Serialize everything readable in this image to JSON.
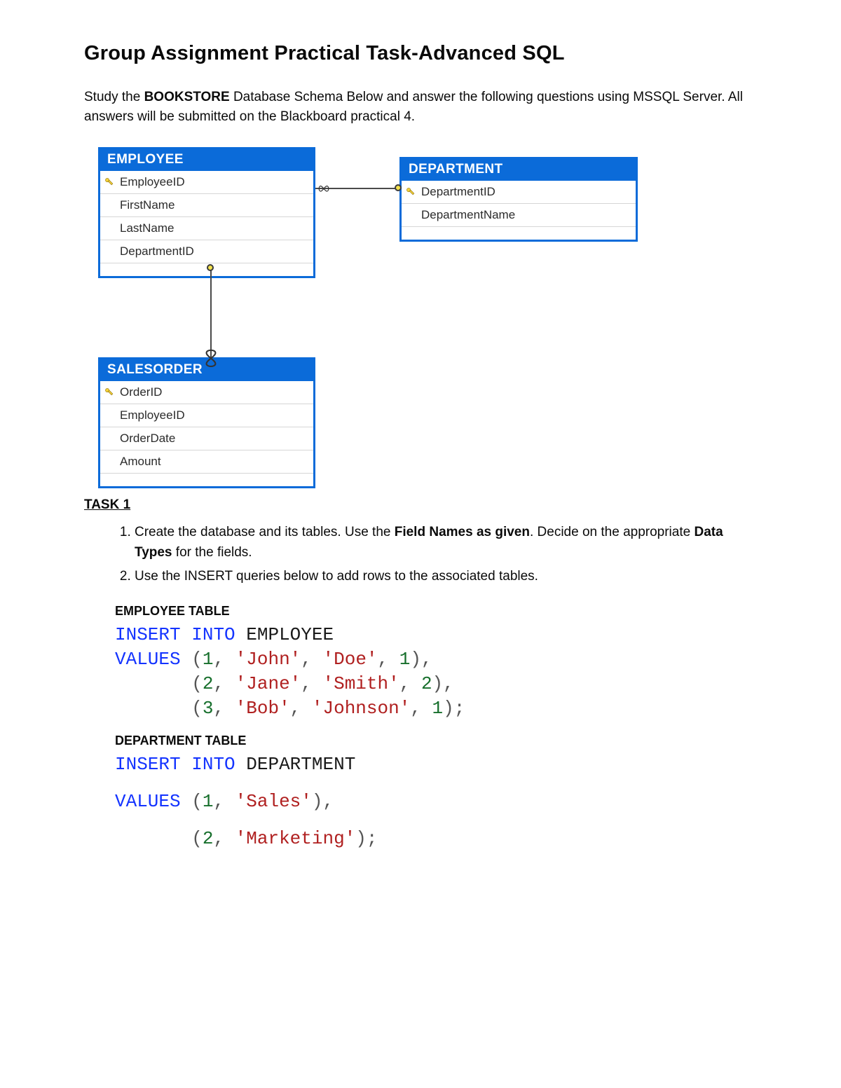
{
  "title": "Group Assignment Practical Task-Advanced SQL",
  "intro": {
    "pre": "Study the ",
    "db_name": "BOOKSTORE",
    "post": " Database Schema Below and answer the following questions using MSSQL Server. All answers will be submitted on the Blackboard practical 4."
  },
  "entities": {
    "employee": {
      "name": "EMPLOYEE",
      "fields": [
        {
          "name": "EmployeeID",
          "pk": true
        },
        {
          "name": "FirstName",
          "pk": false
        },
        {
          "name": "LastName",
          "pk": false
        },
        {
          "name": "DepartmentID",
          "pk": false
        }
      ]
    },
    "department": {
      "name": "DEPARTMENT",
      "fields": [
        {
          "name": "DepartmentID",
          "pk": true
        },
        {
          "name": "DepartmentName",
          "pk": false
        }
      ]
    },
    "salesorder": {
      "name": "SALESORDER",
      "fields": [
        {
          "name": "OrderID",
          "pk": true
        },
        {
          "name": "EmployeeID",
          "pk": false
        },
        {
          "name": "OrderDate",
          "pk": false
        },
        {
          "name": "Amount",
          "pk": false
        }
      ]
    }
  },
  "task_header": "TASK 1",
  "tasks": {
    "t1_a": "Create the database and its tables. Use the ",
    "t1_b": "Field Names as given",
    "t1_c": ". Decide on the appropriate ",
    "t1_d": "Data Types",
    "t1_e": " for the fields.",
    "t2": "Use the INSERT queries below to add rows to the associated tables."
  },
  "sql_headers": {
    "employee": "EMPLOYEE TABLE",
    "department": "DEPARTMENT TABLE"
  },
  "sql": {
    "INSERT": "INSERT",
    "INTO": "INTO",
    "VALUES": "VALUES",
    "emp": {
      "table": "EMPLOYEE",
      "row1": {
        "id": "1",
        "first": "'John'",
        "last": "'Doe'",
        "dept": "1"
      },
      "row2": {
        "id": "2",
        "first": "'Jane'",
        "last": "'Smith'",
        "dept": "2"
      },
      "row3": {
        "id": "3",
        "first": "'Bob'",
        "last": "'Johnson'",
        "dept": "1"
      }
    },
    "dep": {
      "table": "DEPARTMENT",
      "row1": {
        "id": "1",
        "name": "'Sales'"
      },
      "row2": {
        "id": "2",
        "name": "'Marketing'"
      }
    }
  }
}
